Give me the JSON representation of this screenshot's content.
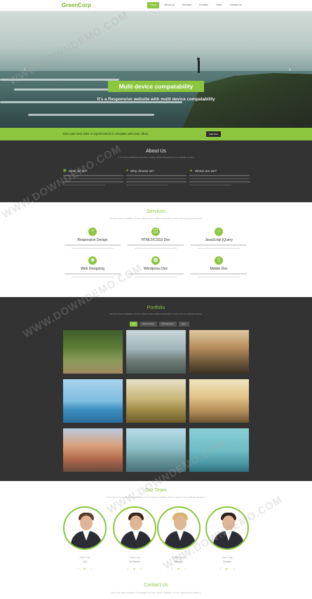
{
  "nav": {
    "logo": "GreenCorp",
    "menu": [
      "Home",
      "About Us",
      "Services",
      "Portfolio",
      "Team",
      "Contact Us"
    ]
  },
  "hero": {
    "title": "Mulit device compatability",
    "subtitle": "It's a Responsive website with mulit device compatability"
  },
  "promo": {
    "text": "Duis aute irure dolor in reprehenderit in voluptate velit esse cillum.",
    "button": "Start Now"
  },
  "about": {
    "title": "About Us",
    "subtitle": "It is a long established fact that a reader will be distracted by the readable content",
    "columns": [
      {
        "icon": "laptop-icon",
        "title": "What we do?"
      },
      {
        "icon": "help-icon",
        "title": "Why choose us?"
      },
      {
        "icon": "location-icon",
        "title": "Where are we?"
      }
    ]
  },
  "services": {
    "title": "Services",
    "subtitle": "All lorem ipsum available, but the majority have suffered alteration in some form by injected humour.",
    "items": [
      {
        "icon": "plus-icon",
        "title": "Responsive Design"
      },
      {
        "icon": "code-icon",
        "title": "HTML5/CSS3 Dev"
      },
      {
        "icon": "bulb-icon",
        "title": "JavaScript jQuery"
      },
      {
        "icon": "globe-icon",
        "title": "Web Designing"
      },
      {
        "icon": "grid-icon",
        "title": "Wordpress Dev"
      },
      {
        "icon": "mobile-icon",
        "title": "Mobile Dev"
      }
    ]
  },
  "portfolio": {
    "title": "Portfolio",
    "subtitle": "All lorem ipsum available, but the majority have suffered alteration in some form by injected humour.",
    "filters": [
      "All",
      "Web Design",
      "Photography",
      "Apps"
    ]
  },
  "team": {
    "title": "Our Team",
    "subtitle": "There are many variations of passages of Lorem Ipsum available, but the majority have suffered alteration.",
    "members": [
      {
        "name": "John Doe",
        "role": "CEO"
      },
      {
        "name": "Larry Doe",
        "role": "Art Director"
      },
      {
        "name": "Ranith Kays",
        "role": "Manager"
      },
      {
        "name": "Joan Ray",
        "role": "Creative"
      }
    ],
    "social": [
      "f",
      "g+",
      "t"
    ]
  },
  "contact": {
    "title": "Contact Us",
    "subtitle": "There are many variations of passages of Lorem Ipsum available, but the majority have suffered."
  },
  "watermark": "WWW.DOWNDEMO.COM",
  "colors": {
    "accent": "#8cc63f",
    "dark": "#333333"
  }
}
